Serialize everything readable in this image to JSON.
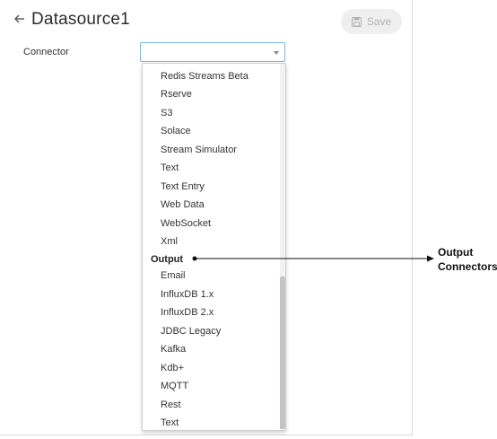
{
  "header": {
    "title": "Datasource1",
    "save_label": "Save"
  },
  "form": {
    "connector_label": "Connector",
    "connector_value": ""
  },
  "dropdown": {
    "items_before": [
      "Redis Streams Beta",
      "Rserve",
      "S3",
      "Solace",
      "Stream Simulator",
      "Text",
      "Text Entry",
      "Web Data",
      "WebSocket",
      "Xml"
    ],
    "group_label": "Output",
    "items_after": [
      "Email",
      "InfluxDB 1.x",
      "InfluxDB 2.x",
      "JDBC Legacy",
      "Kafka",
      "Kdb+",
      "MQTT",
      "Rest",
      "Text"
    ]
  },
  "callout": {
    "line1": "Output",
    "line2": "Connectors"
  }
}
